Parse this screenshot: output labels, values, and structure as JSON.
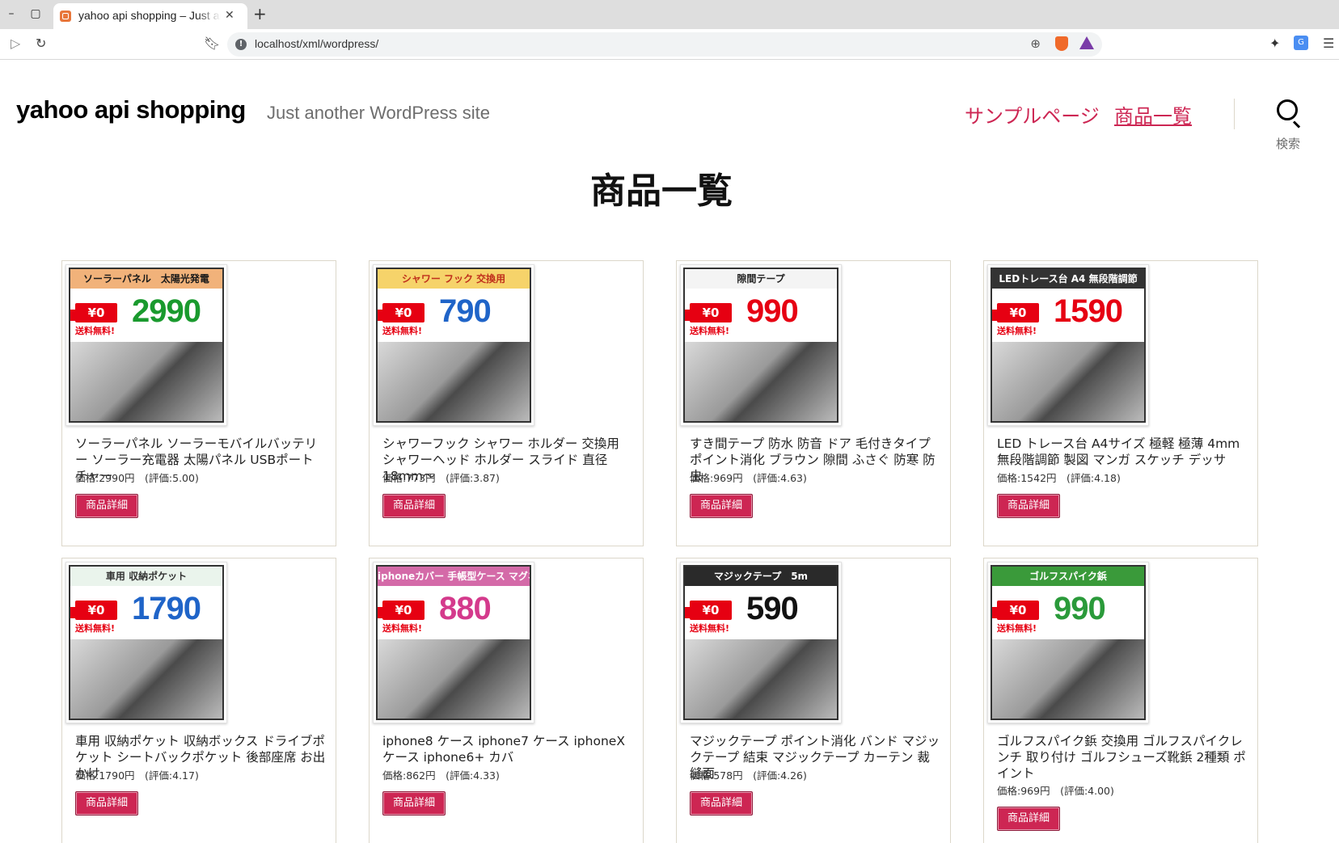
{
  "browser": {
    "tab_title": "yahoo api shopping – Just another WordPress site",
    "tab_close": "✕",
    "new_tab": "+",
    "url": "localhost/xml/wordpress/",
    "minimize": "–",
    "maximize": "▢"
  },
  "site": {
    "title": "yahoo api shopping",
    "description": "Just another WordPress site",
    "nav": [
      {
        "label": "サンプルページ"
      },
      {
        "label": "商品一覧"
      }
    ],
    "search_label": "検索"
  },
  "page": {
    "title": "商品一覧",
    "detail_button_label": "商品詳細"
  },
  "products": [
    {
      "name": "ソーラーパネル ソーラーモバイルバッテリー ソーラー充電器 太陽パネル USBポート チャー",
      "meta": "価格:2990円　(評価:5.00)",
      "thumb_banner": "ソーラーパネル　太陽光発電",
      "thumb_price": "2990",
      "banner_bg": "#f1b27a",
      "banner_fg": "#1a1a1a",
      "price_color": "#1a9a2e"
    },
    {
      "name": "シャワーフック シャワー ホルダー 交換用 シャワーヘッド ホルダー スライド 直径18mm〜",
      "meta": "価格:773円　(評価:3.87)",
      "thumb_banner": "シャワー フック 交換用",
      "thumb_price": "790",
      "banner_bg": "#f6d36a",
      "banner_fg": "#c0301c",
      "price_color": "#1f64c8"
    },
    {
      "name": "すき間テープ 防水 防音 ドア 毛付きタイプ ポイント消化 ブラウン 隙間 ふさぐ 防寒 防虫",
      "meta": "価格:969円　(評価:4.63)",
      "thumb_banner": "隙間テープ",
      "thumb_price": "990",
      "banner_bg": "#f4f4f4",
      "banner_fg": "#222222",
      "price_color": "#e60012"
    },
    {
      "name": "LED トレース台 A4サイズ 極軽 極薄 4mm 無段階調節 製図 マンガ スケッチ デッサ",
      "meta": "価格:1542円　(評価:4.18)",
      "thumb_banner": "LEDトレース台 A4 無段階調節",
      "thumb_price": "1590",
      "banner_bg": "#333333",
      "banner_fg": "#ffffff",
      "price_color": "#e60012"
    },
    {
      "name": "車用 収納ポケット 収納ボックス ドライブポケット シートバックポケット 後部座席 お出かけ",
      "meta": "価格:1790円　(評価:4.17)",
      "thumb_banner": "車用 収納ポケット",
      "thumb_price": "1790",
      "banner_bg": "#eaf4ec",
      "banner_fg": "#333333",
      "price_color": "#1f64c8"
    },
    {
      "name": "iphone8 ケース iphone7 ケース iphoneX ケース iphone6+ カバ",
      "meta": "価格:862円　(評価:4.33)",
      "thumb_banner": "iphoneカバー 手帳型ケース マグネット式",
      "thumb_price": "880",
      "banner_bg": "#d46aa8",
      "banner_fg": "#ffffff",
      "price_color": "#d43a8c"
    },
    {
      "name": "マジックテープ ポイント消化 バンド マジックテープ 結束 マジックテープ カーテン 裁縫面",
      "meta": "価格:578円　(評価:4.26)",
      "thumb_banner": "マジックテープ　5m",
      "thumb_price": "590",
      "banner_bg": "#2a2a2a",
      "banner_fg": "#ffffff",
      "price_color": "#111111"
    },
    {
      "name": "ゴルフスパイク鋲 交換用 ゴルフスパイクレンチ 取り付け ゴルフシューズ靴鋲 2種類 ポイント",
      "meta": "価格:969円　(評価:4.00)",
      "thumb_banner": "ゴルフスパイク鋲",
      "thumb_price": "990",
      "banner_bg": "#3a9a3a",
      "banner_fg": "#ffffff",
      "price_color": "#2a9a3a"
    }
  ],
  "colors": {
    "accent": "#cd2653",
    "border": "#dcd7ca"
  }
}
